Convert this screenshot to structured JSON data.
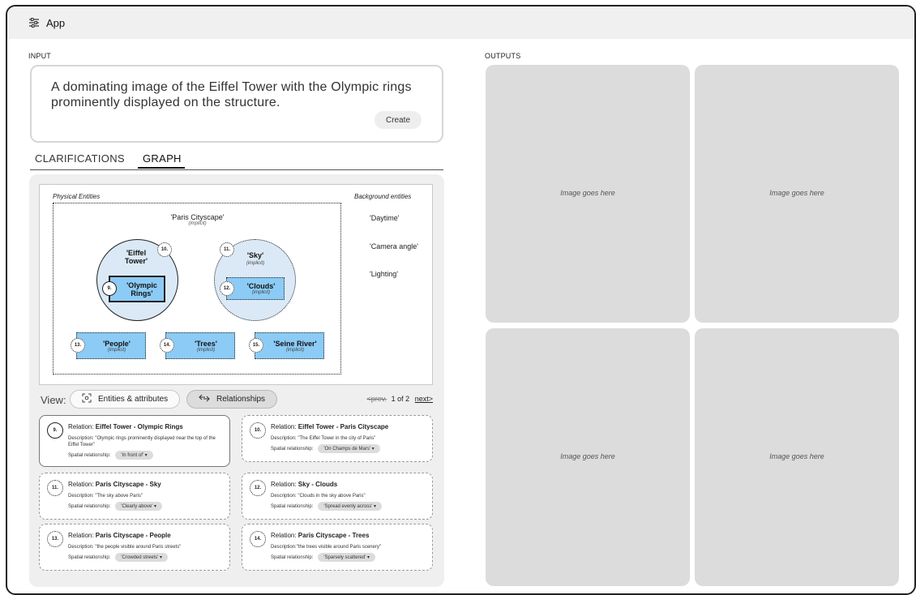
{
  "app": {
    "title": "App",
    "icon": "app-settings-icon"
  },
  "input": {
    "section_label": "INPUT",
    "prompt": "A dominating image of the Eiffel Tower with the Olympic rings prominently displayed on the structure.",
    "create_label": "Create"
  },
  "tabs": [
    {
      "label": "CLARIFICATIONS",
      "active": false
    },
    {
      "label": "GRAPH",
      "active": true
    }
  ],
  "graph": {
    "physical_label": "Physical Entities",
    "background_label": "Background entities",
    "scene": {
      "name": "'Paris Cityscape'",
      "note": "(implicit)"
    },
    "eiffel": {
      "num": "10.",
      "name": "'Eiffel Tower'"
    },
    "olympic": {
      "num": "9.",
      "name": "'Olympic Rings'"
    },
    "sky": {
      "num": "11.",
      "name": "'Sky'",
      "note": "(implicit)"
    },
    "clouds": {
      "num": "12.",
      "name": "'Clouds'",
      "note": "(implicit)"
    },
    "people": {
      "num": "13.",
      "name": "'People'",
      "note": "(implicit)"
    },
    "trees": {
      "num": "14.",
      "name": "'Trees'",
      "note": "(implicit)"
    },
    "seine": {
      "num": "15.",
      "name": "'Seine River'",
      "note": "(implicit)"
    },
    "background": [
      "'Daytime'",
      "'Camera angle'",
      "'Lighting'"
    ]
  },
  "view": {
    "label": "View:",
    "entities_label": "Entities & attributes",
    "relationships_label": "Relationships",
    "active": "Relationships",
    "prev_label": "<prev.",
    "page_text": "1 of 2",
    "next_label": "next>"
  },
  "relations": [
    {
      "num": "9.",
      "pair": "Eiffel Tower - Olympic Rings",
      "description": "Description: \"Olympic rings prominently displayed near the top of the Eiffel Tower\"",
      "spatial_label": "Spatial relationship:",
      "spatial": "'In front of' ▾",
      "selected": true
    },
    {
      "num": "10.",
      "pair": "Eiffel Tower - Paris Cityscape",
      "description": "Description: \"The Eiffel Tower in the city of Paris\"",
      "spatial_label": "Spatial relationship:",
      "spatial": "'On Champs de Mars' ▾",
      "selected": false
    },
    {
      "num": "11.",
      "pair": "Paris Cityscape - Sky",
      "description": "Description: \"The sky above Paris\"",
      "spatial_label": "Spatial relationship:",
      "spatial": "'Clearly above' ▾",
      "selected": false
    },
    {
      "num": "12.",
      "pair": "Sky - Clouds",
      "description": "Description: \"Clouds in the sky above Paris\"",
      "spatial_label": "Spatial relationship:",
      "spatial": "'Spread evenly across' ▾",
      "selected": false
    },
    {
      "num": "13.",
      "pair": "Paris Cityscape - People",
      "description": "Description: \"the people visible around Paris streets\"",
      "spatial_label": "Spatial relationship:",
      "spatial": "'Crowded streets' ▾",
      "selected": false
    },
    {
      "num": "14.",
      "pair": "Paris Cityscape - Trees",
      "description": "Description:\"the trees visible around Paris scenery\"",
      "spatial_label": "Spatial relationship:",
      "spatial": "'Sparsely scattered' ▾",
      "selected": false
    }
  ],
  "outputs": {
    "section_label": "OUTPUTS",
    "images": [
      "Image goes here",
      "Image goes here",
      "Image goes here",
      "Image goes here"
    ]
  }
}
